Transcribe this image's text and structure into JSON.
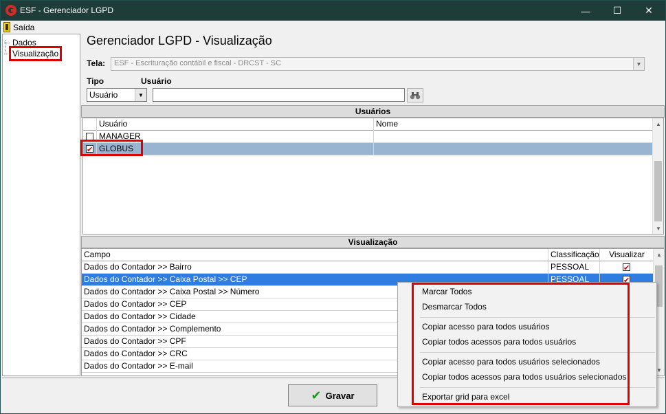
{
  "window": {
    "title": "ESF - Gerenciador LGPD",
    "minimize": "—",
    "maximize": "☐",
    "close": "✕"
  },
  "menu": {
    "exit_label": "Saída"
  },
  "tree": {
    "items": [
      "Dados",
      "Visualização"
    ]
  },
  "page": {
    "title": "Gerenciador LGPD - Visualização",
    "tela_label": "Tela:",
    "tela_value": "ESF - Escrituração contábil e fiscal - DRCST - SC",
    "tipo_label": "Tipo",
    "usuario_label": "Usuário",
    "tipo_value": "Usuário",
    "usuario_value": ""
  },
  "users_section": {
    "title": "Usuários",
    "columns": [
      "Usuário",
      "Nome"
    ],
    "rows": [
      {
        "usuario": "MANAGER",
        "nome": "",
        "checked": false
      },
      {
        "usuario": "GLOBUS",
        "nome": "",
        "checked": true
      }
    ]
  },
  "vis_section": {
    "title": "Visualização",
    "columns": [
      "Campo",
      "Classificação",
      "Visualizar"
    ],
    "rows": [
      {
        "campo": "Dados do Contador >> Bairro",
        "classificacao": "PESSOAL",
        "visualizar": true
      },
      {
        "campo": "Dados do Contador >> Caixa Postal >> CEP",
        "classificacao": "PESSOAL",
        "visualizar": true
      },
      {
        "campo": "Dados do Contador >> Caixa Postal >> Número",
        "classificacao": "",
        "visualizar": false
      },
      {
        "campo": "Dados do Contador >> CEP",
        "classificacao": "",
        "visualizar": false
      },
      {
        "campo": "Dados do Contador >> Cidade",
        "classificacao": "",
        "visualizar": false
      },
      {
        "campo": "Dados do Contador >> Complemento",
        "classificacao": "",
        "visualizar": false
      },
      {
        "campo": "Dados do Contador >> CPF",
        "classificacao": "",
        "visualizar": false
      },
      {
        "campo": "Dados do Contador >> CRC",
        "classificacao": "",
        "visualizar": false
      },
      {
        "campo": "Dados do Contador >> E-mail",
        "classificacao": "",
        "visualizar": false
      }
    ]
  },
  "buttons": {
    "gravar": "Gravar"
  },
  "context_menu": {
    "items": [
      "Marcar Todos",
      "Desmarcar Todos",
      "Copiar acesso para todos usuários",
      "Copiar todos acessos para todos usuários",
      "Copiar acesso para todos usuários selecionados",
      "Copiar todos acessos para todos usuários selecionados",
      "Exportar grid para excel"
    ]
  },
  "colors": {
    "titlebar": "#1e3c38",
    "highlight": "#e00000",
    "selection": "#2f7de1",
    "row_selected": "#99b4d1"
  }
}
